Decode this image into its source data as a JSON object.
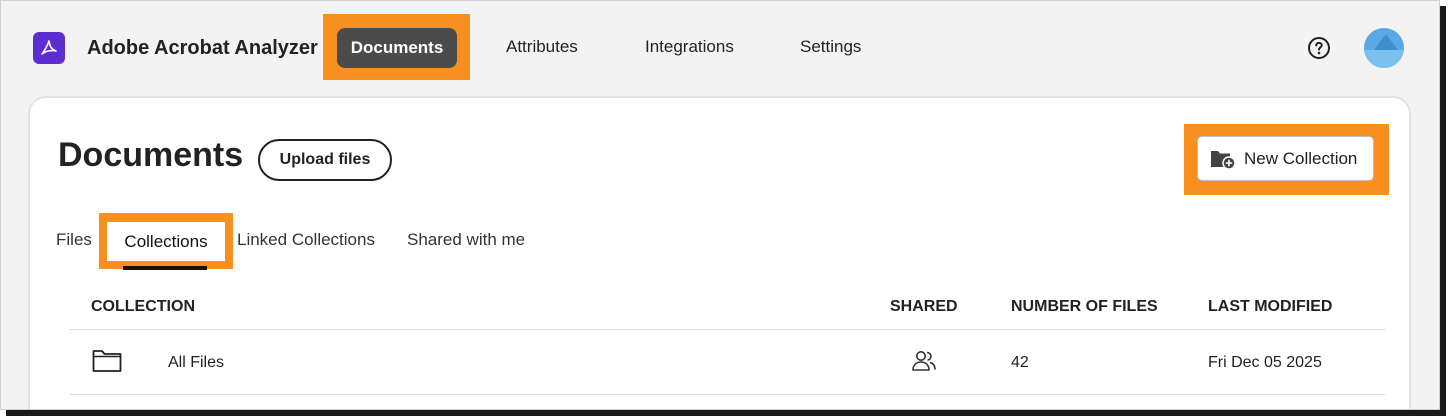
{
  "app": {
    "title": "Adobe Acrobat Analyzer",
    "logo_icon": "acrobat-icon"
  },
  "nav": {
    "items": [
      {
        "label": "Documents",
        "active": true
      },
      {
        "label": "Attributes"
      },
      {
        "label": "Integrations"
      },
      {
        "label": "Settings"
      }
    ],
    "help_icon": "help-circle-icon",
    "avatar_icon": "user-avatar"
  },
  "page": {
    "title": "Documents",
    "upload_label": "Upload files",
    "new_collection_label": "New Collection",
    "new_collection_icon": "folder-add-icon"
  },
  "tabs": [
    {
      "label": "Files"
    },
    {
      "label": "Collections",
      "active": true
    },
    {
      "label": "Linked Collections"
    },
    {
      "label": "Shared with me"
    }
  ],
  "table": {
    "headers": {
      "collection": "COLLECTION",
      "shared": "SHARED",
      "number_of_files": "NUMBER OF FILES",
      "last_modified": "LAST MODIFIED"
    },
    "rows": [
      {
        "icon": "folder-icon",
        "name": "All Files",
        "shared_icon": "users-icon",
        "number_of_files": "42",
        "last_modified": "Fri Dec 05 2025"
      }
    ]
  },
  "colors": {
    "highlight": "#f7901e",
    "active_nav_bg": "#4b4b4b",
    "brand": "#5c2ed2"
  }
}
